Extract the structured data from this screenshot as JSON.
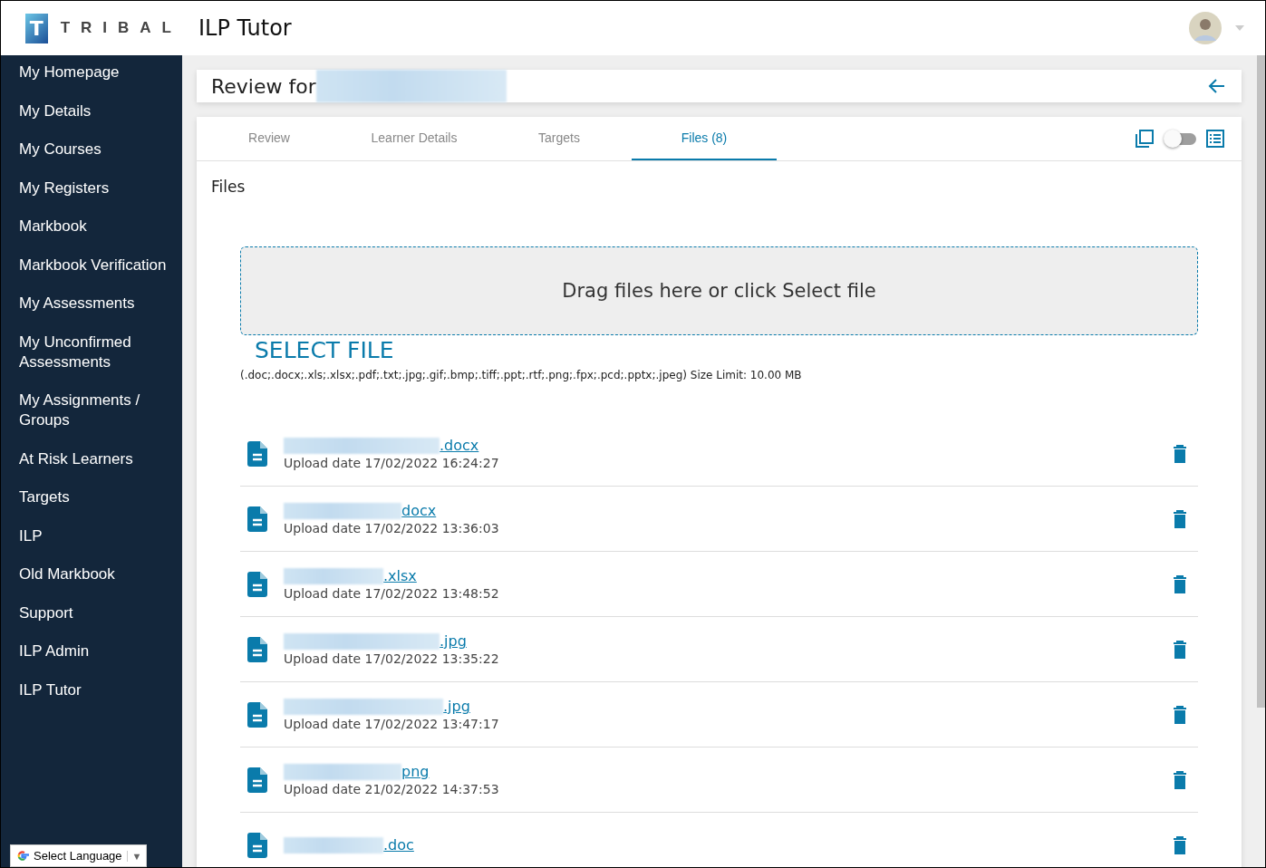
{
  "header": {
    "logo_letter": "T",
    "brand": "TRIBAL",
    "title": "ILP Tutor"
  },
  "sidebar": {
    "items": [
      {
        "label": "My Homepage",
        "selected": false
      },
      {
        "label": "My Details",
        "selected": false
      },
      {
        "label": "My Courses",
        "selected": false
      },
      {
        "label": "My Registers",
        "selected": false
      },
      {
        "label": "Markbook",
        "selected": false
      },
      {
        "label": "Markbook Verification",
        "selected": false
      },
      {
        "label": "My Assessments",
        "selected": false
      },
      {
        "label": "My Unconfirmed Assessments",
        "selected": false
      },
      {
        "label": "My Assignments / Groups",
        "selected": false
      },
      {
        "label": "At Risk Learners",
        "selected": false
      },
      {
        "label": "Targets",
        "selected": false
      },
      {
        "label": "ILP",
        "selected": false
      },
      {
        "label": "Old Markbook",
        "selected": false
      },
      {
        "label": "Support",
        "selected": false
      },
      {
        "label": "ILP Admin",
        "selected": false
      },
      {
        "label": "ILP Tutor",
        "selected": false
      }
    ],
    "language": {
      "label": "Select Language",
      "caret": "▼"
    }
  },
  "review": {
    "title": "Review for"
  },
  "tabs": [
    {
      "label": "Review",
      "selected": false
    },
    {
      "label": "Learner Details",
      "selected": false
    },
    {
      "label": "Targets",
      "selected": false
    },
    {
      "label": "Files (8)",
      "selected": true
    }
  ],
  "view_toggle": {
    "on": false
  },
  "files_section": {
    "title": "Files",
    "dropzone": "Drag files here or click Select file",
    "select_button": "SELECT FILE",
    "allowed": "(.doc;.docx;.xls;.xlsx;.pdf;.txt;.jpg;.gif;.bmp;.tiff;.ppt;.rtf;.png;.fpx;.pcd;.pptx;.jpeg) Size Limit: 10.00 MB"
  },
  "files": [
    {
      "name": ".docx",
      "date": "Upload date 17/02/2022 16:24:27"
    },
    {
      "name": "docx",
      "date": "Upload date 17/02/2022 13:36:03"
    },
    {
      "name": ".xlsx",
      "date": "Upload date 17/02/2022 13:48:52"
    },
    {
      "name": ".jpg",
      "date": "Upload date 17/02/2022 13:35:22"
    },
    {
      "name": ".jpg",
      "date": "Upload date 17/02/2022 13:47:17"
    },
    {
      "name": "png",
      "date": "Upload date 21/02/2022 14:37:53"
    },
    {
      "name": ".doc"
    }
  ]
}
